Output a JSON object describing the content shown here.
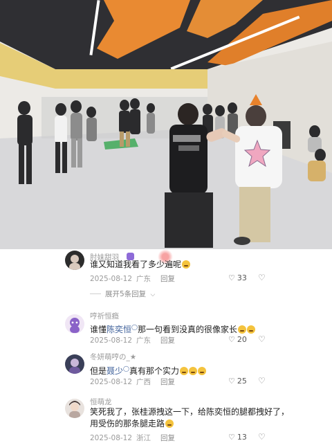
{
  "comments": [
    {
      "username": "肘妹甜羽",
      "text_parts": [
        {
          "t": "谁又知道我看了多少遍呢"
        }
      ],
      "emojis": 1,
      "date": "2025-08-12",
      "location": "广东",
      "reply_label": "回复",
      "likes": "33"
    },
    {
      "username": "哼祈恒瘾",
      "text_parts": [
        {
          "t": "谁懂"
        },
        {
          "t": "陈奕恒",
          "mention": true
        },
        {
          "t": "那一句看到没真的很像家长"
        }
      ],
      "emojis": 2,
      "date": "2025-08-12",
      "location": "广东",
      "reply_label": "回复",
      "likes": "20"
    },
    {
      "username": "冬妍萌哼の_★",
      "text_parts": [
        {
          "t": "但是"
        },
        {
          "t": "聂少",
          "mention": true
        },
        {
          "t": "真有那个实力"
        }
      ],
      "emojis": 3,
      "date": "2025-08-12",
      "location": "广西",
      "reply_label": "回复",
      "likes": "25"
    },
    {
      "username": "恒萌龙",
      "text_parts": [
        {
          "t": "笑死我了，张桂源拽这一下，给陈奕恒的腿都拽好了，用受伤的那条腿走路"
        }
      ],
      "emojis": 1,
      "date": "2025-08-12",
      "location": "浙江",
      "reply_label": "回复",
      "likes": "13"
    }
  ],
  "expand_replies_label": "展开5条回复",
  "colors": {
    "mention": "#3d5f99",
    "meta": "#9a9a9a",
    "text": "#1e1e1e"
  },
  "icons": {
    "like": "heart-outline-icon",
    "dislike": "broken-heart-icon",
    "expand": "chevron-down-icon",
    "search": "search-icon"
  }
}
